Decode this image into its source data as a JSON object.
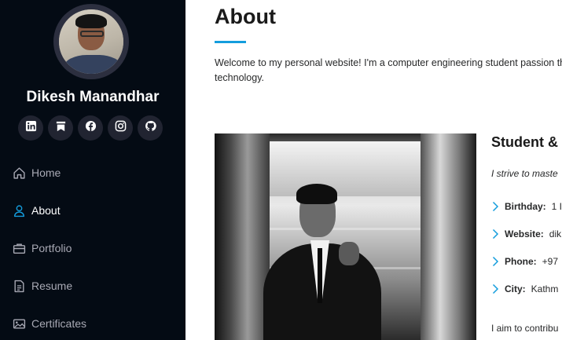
{
  "profile": {
    "name": "Dikesh Manandhar"
  },
  "socials": [
    {
      "icon": "linkedin-icon"
    },
    {
      "icon": "bookmark-icon"
    },
    {
      "icon": "facebook-icon"
    },
    {
      "icon": "instagram-icon"
    },
    {
      "icon": "github-icon"
    }
  ],
  "nav": {
    "items": [
      {
        "label": "Home",
        "icon": "home-icon"
      },
      {
        "label": "About",
        "icon": "person-icon",
        "active": true
      },
      {
        "label": "Portfolio",
        "icon": "briefcase-icon"
      },
      {
        "label": "Resume",
        "icon": "document-icon"
      },
      {
        "label": "Certificates",
        "icon": "image-icon"
      }
    ]
  },
  "about": {
    "title": "About",
    "intro": "Welcome to my personal website! I'm a computer engineering student passion the world of technology.",
    "subtitle": "Student &",
    "lead": "I strive to maste",
    "details": [
      {
        "label": "Birthday:",
        "value": "1 I"
      },
      {
        "label": "Website:",
        "value": "dik"
      },
      {
        "label": "Phone:",
        "value": "+97"
      },
      {
        "label": "City:",
        "value": "Kathm"
      }
    ],
    "outro": "I aim to contribu"
  },
  "colors": {
    "sidebar_bg": "#040b14",
    "accent": "#149ddd",
    "social_bg": "#212431"
  }
}
